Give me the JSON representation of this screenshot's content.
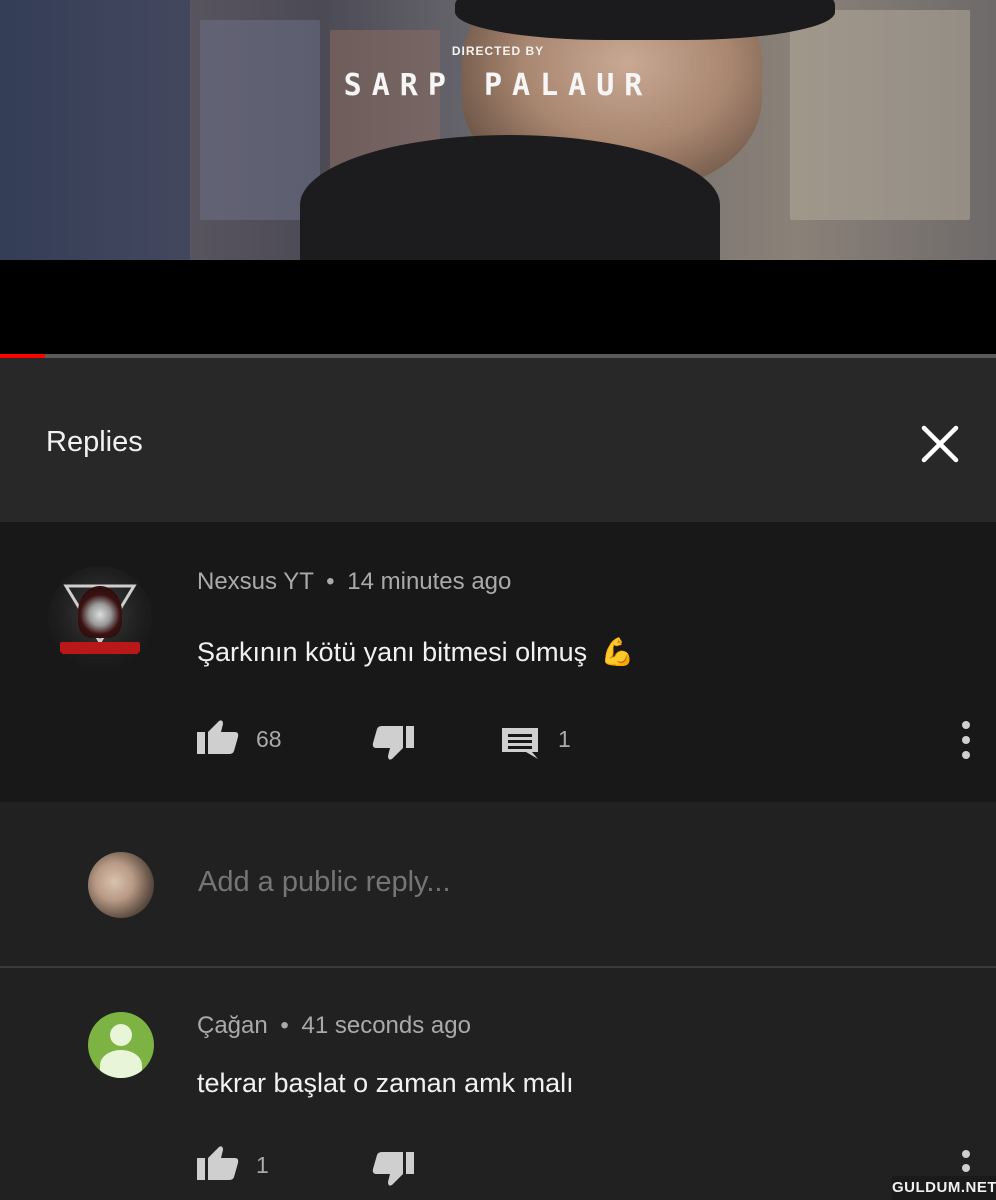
{
  "video": {
    "overlay_small": "DIRECTED BY",
    "overlay_big": "SARP PALAUR",
    "progress_fraction": 0.045,
    "progress_color": "#ff0000"
  },
  "panel": {
    "title": "Replies",
    "close_icon": "close-icon"
  },
  "comment": {
    "author": "Nexsus YT",
    "separator": "•",
    "time": "14 minutes ago",
    "text": "Şarkının kötü yanı bitmesi olmuş",
    "emoji": "💪",
    "likes": "68",
    "replies": "1",
    "avatar_icon": "channel-avatar",
    "more_icon": "more-vert-icon"
  },
  "reply_box": {
    "placeholder": "Add a public reply..."
  },
  "reply": {
    "author": "Çağan",
    "separator": "•",
    "time": "41 seconds ago",
    "text": "tekrar başlat o zaman amk malı",
    "likes": "1",
    "avatar_color": "#7cb342"
  },
  "watermark": "GULDUM.NET"
}
